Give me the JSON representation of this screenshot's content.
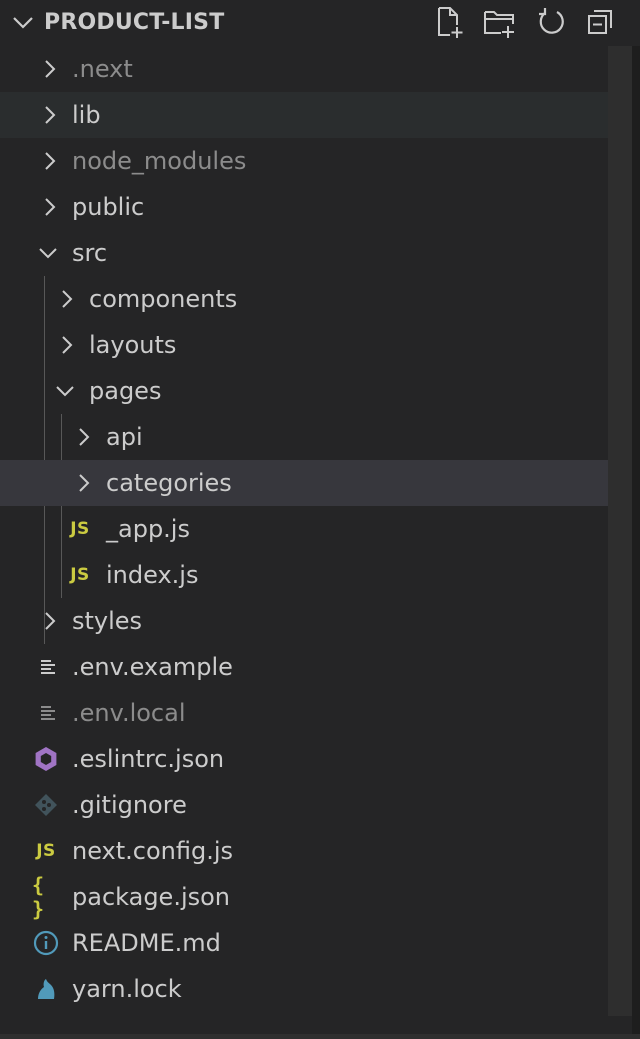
{
  "explorer": {
    "title": "PRODUCT-LIST",
    "actions": [
      {
        "name": "new-file-icon"
      },
      {
        "name": "new-folder-icon"
      },
      {
        "name": "refresh-icon"
      },
      {
        "name": "collapse-all-icon"
      }
    ]
  },
  "tree": {
    "items": [
      {
        "label": ".next",
        "type": "folder",
        "expanded": false,
        "dim": true
      },
      {
        "label": "lib",
        "type": "folder",
        "expanded": false,
        "dim": false
      },
      {
        "label": "node_modules",
        "type": "folder",
        "expanded": false,
        "dim": true
      },
      {
        "label": "public",
        "type": "folder",
        "expanded": false,
        "dim": false
      },
      {
        "label": "src",
        "type": "folder",
        "expanded": true,
        "dim": false
      },
      {
        "label": "components",
        "type": "folder",
        "expanded": false,
        "dim": false
      },
      {
        "label": "layouts",
        "type": "folder",
        "expanded": false,
        "dim": false
      },
      {
        "label": "pages",
        "type": "folder",
        "expanded": true,
        "dim": false
      },
      {
        "label": "api",
        "type": "folder",
        "expanded": false,
        "dim": false
      },
      {
        "label": "categories",
        "type": "folder",
        "expanded": false,
        "dim": false
      },
      {
        "label": "_app.js",
        "type": "file",
        "icon": "js-file-icon",
        "badge": "JS",
        "dim": false
      },
      {
        "label": "index.js",
        "type": "file",
        "icon": "js-file-icon",
        "badge": "JS",
        "dim": false
      },
      {
        "label": "styles",
        "type": "folder",
        "expanded": false,
        "dim": false
      },
      {
        "label": ".env.example",
        "type": "file",
        "icon": "text-lines-icon",
        "dim": false
      },
      {
        "label": ".env.local",
        "type": "file",
        "icon": "text-lines-icon",
        "dim": true
      },
      {
        "label": ".eslintrc.json",
        "type": "file",
        "icon": "eslint-icon",
        "dim": false
      },
      {
        "label": ".gitignore",
        "type": "file",
        "icon": "git-icon",
        "dim": false
      },
      {
        "label": "next.config.js",
        "type": "file",
        "icon": "js-file-icon",
        "badge": "JS",
        "dim": false
      },
      {
        "label": "package.json",
        "type": "file",
        "icon": "json-braces-icon",
        "badge": "{ }",
        "dim": false
      },
      {
        "label": "README.md",
        "type": "file",
        "icon": "info-icon",
        "dim": false
      },
      {
        "label": "yarn.lock",
        "type": "file",
        "icon": "yarn-icon",
        "dim": false
      }
    ]
  },
  "colors": {
    "background": "#252526",
    "text": "#cccccc",
    "dim_text": "#8c8c8c",
    "js_yellow": "#cbcb41",
    "eslint_purple": "#a074c4",
    "info_blue": "#519aba",
    "yarn_blue": "#519aba",
    "selected_row": "#37373d",
    "focused_row": "#2a2d2e"
  }
}
